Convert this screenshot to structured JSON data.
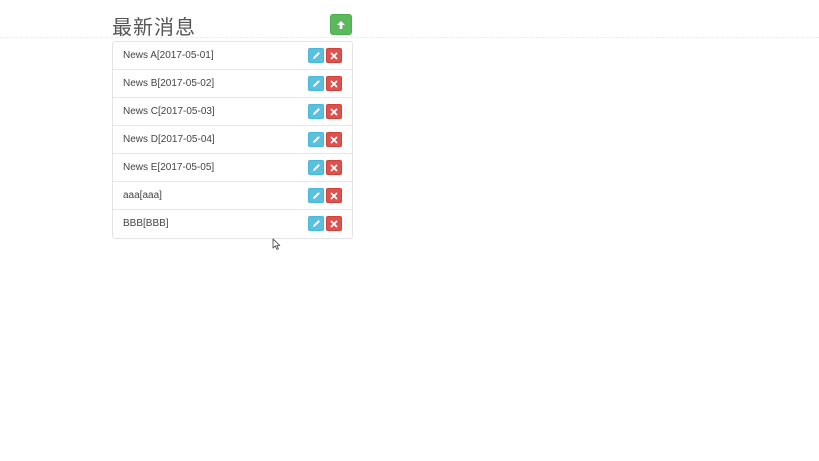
{
  "panel": {
    "title": "最新消息",
    "add_icon": "arrow-up-icon"
  },
  "news": {
    "items": [
      {
        "label": "News A[2017-05-01]"
      },
      {
        "label": "News B[2017-05-02]"
      },
      {
        "label": "News C[2017-05-03]"
      },
      {
        "label": "News D[2017-05-04]"
      },
      {
        "label": "News E[2017-05-05]"
      },
      {
        "label": "aaa[aaa]"
      },
      {
        "label": "BBB[BBB]"
      }
    ],
    "edit_icon": "pencil-icon",
    "delete_icon": "close-icon"
  },
  "colors": {
    "success": "#5cb85c",
    "info": "#5bc0de",
    "danger": "#d9534f"
  }
}
